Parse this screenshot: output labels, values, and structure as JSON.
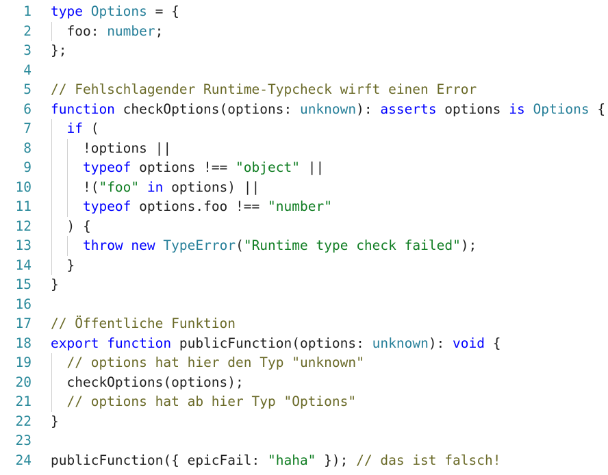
{
  "colors": {
    "keyword": "#0000ff",
    "type": "#267f99",
    "string": "#0f7d22",
    "comment": "#6a6a28",
    "line_number": "#2b8a9b",
    "text": "#1f1f1f"
  },
  "lines": [
    {
      "n": "1",
      "tokens": [
        [
          "kw",
          "type"
        ],
        [
          "plain",
          " "
        ],
        [
          "type",
          "Options"
        ],
        [
          "plain",
          " = {"
        ]
      ]
    },
    {
      "n": "2",
      "tokens": [
        [
          "plain",
          "  foo: "
        ],
        [
          "type",
          "number"
        ],
        [
          "plain",
          ";"
        ]
      ]
    },
    {
      "n": "3",
      "tokens": [
        [
          "plain",
          "};"
        ]
      ]
    },
    {
      "n": "4",
      "tokens": []
    },
    {
      "n": "5",
      "tokens": [
        [
          "comment",
          "// Fehlschlagender Runtime-Typcheck wirft einen Error"
        ]
      ]
    },
    {
      "n": "6",
      "tokens": [
        [
          "kw",
          "function"
        ],
        [
          "plain",
          " checkOptions(options: "
        ],
        [
          "type",
          "unknown"
        ],
        [
          "plain",
          "): "
        ],
        [
          "kw",
          "asserts"
        ],
        [
          "plain",
          " options "
        ],
        [
          "kw",
          "is"
        ],
        [
          "plain",
          " "
        ],
        [
          "type",
          "Options"
        ],
        [
          "plain",
          " {"
        ]
      ]
    },
    {
      "n": "7",
      "tokens": [
        [
          "plain",
          "  "
        ],
        [
          "kw",
          "if"
        ],
        [
          "plain",
          " ("
        ]
      ]
    },
    {
      "n": "8",
      "tokens": [
        [
          "plain",
          "    !options ||"
        ]
      ]
    },
    {
      "n": "9",
      "tokens": [
        [
          "plain",
          "    "
        ],
        [
          "kw",
          "typeof"
        ],
        [
          "plain",
          " options !== "
        ],
        [
          "str2",
          "\"object\""
        ],
        [
          "plain",
          " ||"
        ]
      ]
    },
    {
      "n": "10",
      "tokens": [
        [
          "plain",
          "    !("
        ],
        [
          "str2",
          "\"foo\""
        ],
        [
          "plain",
          " "
        ],
        [
          "kw",
          "in"
        ],
        [
          "plain",
          " options) ||"
        ]
      ]
    },
    {
      "n": "11",
      "tokens": [
        [
          "plain",
          "    "
        ],
        [
          "kw",
          "typeof"
        ],
        [
          "plain",
          " options.foo !== "
        ],
        [
          "str2",
          "\"number\""
        ]
      ]
    },
    {
      "n": "12",
      "tokens": [
        [
          "plain",
          "  ) {"
        ]
      ]
    },
    {
      "n": "13",
      "tokens": [
        [
          "plain",
          "    "
        ],
        [
          "kw",
          "throw"
        ],
        [
          "plain",
          " "
        ],
        [
          "kw",
          "new"
        ],
        [
          "plain",
          " "
        ],
        [
          "type",
          "TypeError"
        ],
        [
          "plain",
          "("
        ],
        [
          "str2",
          "\"Runtime type check failed\""
        ],
        [
          "plain",
          ");"
        ]
      ]
    },
    {
      "n": "14",
      "tokens": [
        [
          "plain",
          "  }"
        ]
      ]
    },
    {
      "n": "15",
      "tokens": [
        [
          "plain",
          "}"
        ]
      ]
    },
    {
      "n": "16",
      "tokens": []
    },
    {
      "n": "17",
      "tokens": [
        [
          "comment",
          "// Öffentliche Funktion"
        ]
      ]
    },
    {
      "n": "18",
      "tokens": [
        [
          "kw",
          "export"
        ],
        [
          "plain",
          " "
        ],
        [
          "kw",
          "function"
        ],
        [
          "plain",
          " publicFunction(options: "
        ],
        [
          "type",
          "unknown"
        ],
        [
          "plain",
          "): "
        ],
        [
          "kw",
          "void"
        ],
        [
          "plain",
          " {"
        ]
      ]
    },
    {
      "n": "19",
      "tokens": [
        [
          "plain",
          "  "
        ],
        [
          "comment",
          "// options hat hier den Typ \"unknown\""
        ]
      ]
    },
    {
      "n": "20",
      "tokens": [
        [
          "plain",
          "  checkOptions(options);"
        ]
      ]
    },
    {
      "n": "21",
      "tokens": [
        [
          "plain",
          "  "
        ],
        [
          "comment",
          "// options hat ab hier Typ \"Options\""
        ]
      ]
    },
    {
      "n": "22",
      "tokens": [
        [
          "plain",
          "}"
        ]
      ]
    },
    {
      "n": "23",
      "tokens": []
    },
    {
      "n": "24",
      "tokens": [
        [
          "plain",
          "publicFunction({ epicFail: "
        ],
        [
          "str2",
          "\"haha\""
        ],
        [
          "plain",
          " }); "
        ],
        [
          "comment",
          "// das ist falsch!"
        ]
      ]
    }
  ]
}
